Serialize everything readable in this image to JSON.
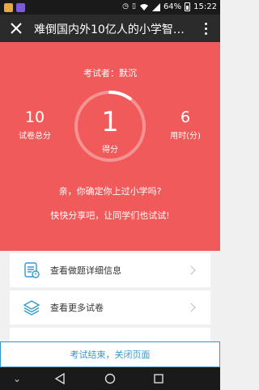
{
  "status_bar": {
    "notif_colors": [
      "#e8a83c",
      "#7b5cd6"
    ],
    "battery": "64%",
    "time": "15:22",
    "icons": [
      "clock-icon",
      "vibrate-icon",
      "wifi-icon",
      "signal-icon",
      "battery-icon"
    ]
  },
  "header": {
    "title": "难倒国内外10亿人的小学智…"
  },
  "result": {
    "examinee": "考试者：默沉",
    "total_score_value": "10",
    "total_score_label": "试卷总分",
    "score_value": "1",
    "score_label": "得分",
    "time_value": "6",
    "time_label": "用时(分)",
    "progress_fraction": 0.1,
    "message_line1": "亲，你确定你上过小学吗?",
    "message_line2": "快快分享吧，让同学们也试试!"
  },
  "actions": [
    {
      "label": "查看做题详细信息",
      "icon": "document-detail-icon"
    },
    {
      "label": "查看更多试卷",
      "icon": "layers-icon"
    }
  ],
  "footer": {
    "end_label": "考试结束，关闭页面"
  },
  "colors": {
    "hero_bg": "#f05a5a",
    "accent_blue": "#3399cc",
    "title_bar": "#2b2b2b"
  }
}
